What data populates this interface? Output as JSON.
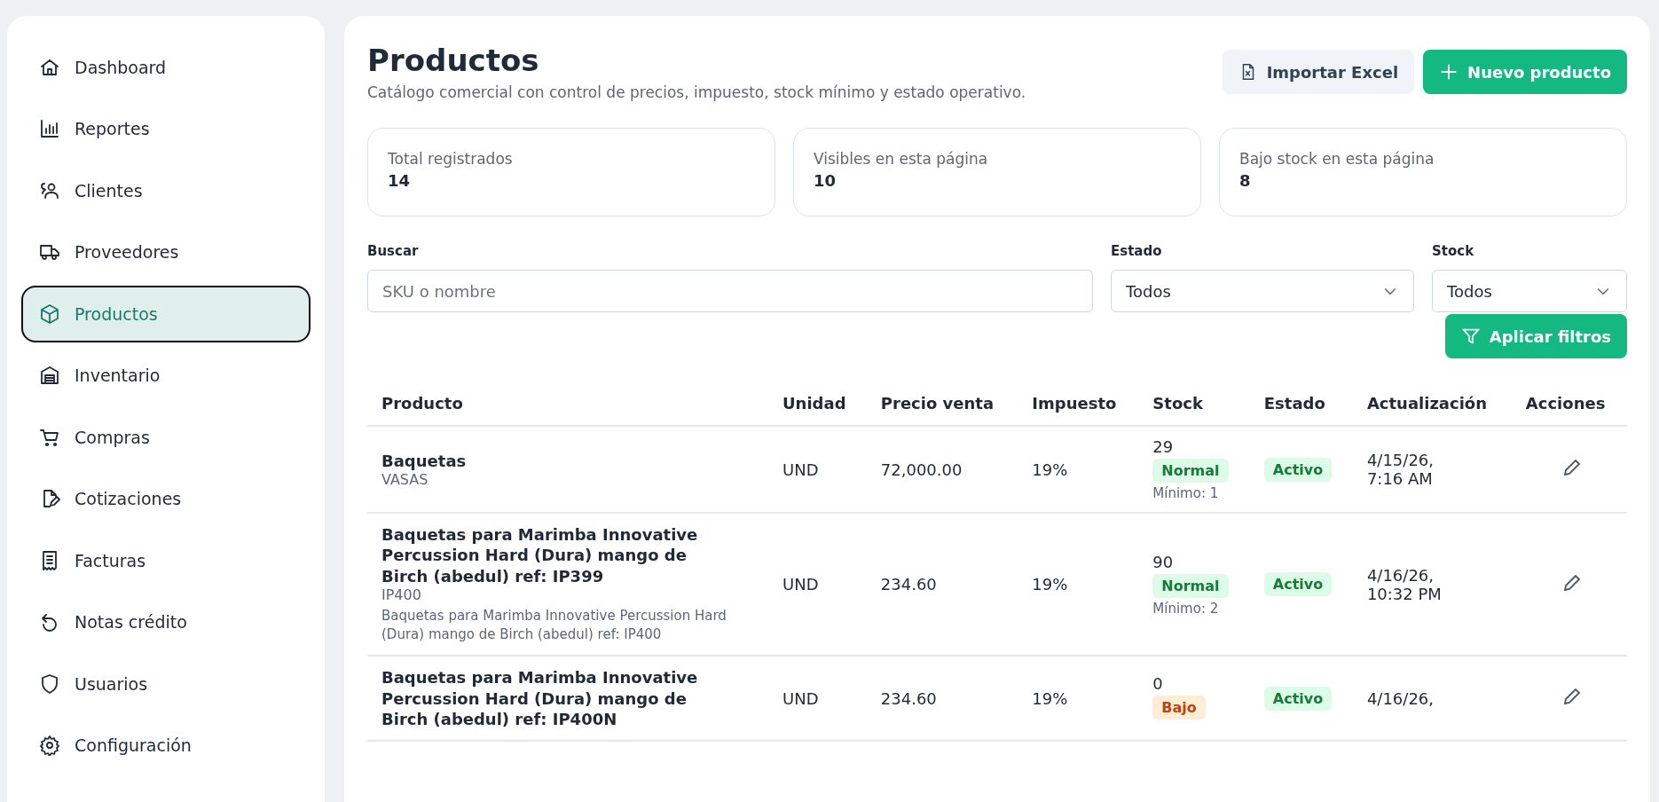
{
  "sidebar": {
    "items": [
      {
        "label": "Dashboard",
        "kind": "home",
        "selected": false
      },
      {
        "label": "Reportes",
        "kind": "chart",
        "selected": false
      },
      {
        "label": "Clientes",
        "kind": "users",
        "selected": false
      },
      {
        "label": "Proveedores",
        "kind": "truck",
        "selected": false
      },
      {
        "label": "Productos",
        "kind": "box",
        "selected": true
      },
      {
        "label": "Inventario",
        "kind": "warehouse",
        "selected": false
      },
      {
        "label": "Compras",
        "kind": "cart",
        "selected": false
      },
      {
        "label": "Cotizaciones",
        "kind": "doc",
        "selected": false
      },
      {
        "label": "Facturas",
        "kind": "receipt",
        "selected": false
      },
      {
        "label": "Notas crédito",
        "kind": "undo",
        "selected": false
      },
      {
        "label": "Usuarios",
        "kind": "shield",
        "selected": false
      },
      {
        "label": "Configuración",
        "kind": "gear",
        "selected": false
      }
    ]
  },
  "header": {
    "title": "Productos",
    "subtitle": "Catálogo comercial con control de precios, impuesto, stock mínimo y estado operativo.",
    "buttons": [
      {
        "label": "Importar Excel",
        "kind": "secondary"
      },
      {
        "label": "Nuevo producto",
        "kind": "primary"
      }
    ]
  },
  "stats": [
    {
      "label": "Total registrados",
      "value": "14"
    },
    {
      "label": "Visibles en esta página",
      "value": "10"
    },
    {
      "label": "Bajo stock en esta página",
      "value": "8"
    }
  ],
  "filters": {
    "search": {
      "label": "Buscar",
      "placeholder": "SKU o nombre"
    },
    "estado": {
      "label": "Estado",
      "value": "Todos"
    },
    "stock": {
      "label": "Stock",
      "value": "Todos"
    },
    "apply": "Aplicar filtros"
  },
  "table": {
    "columns": [
      "Producto",
      "Unidad",
      "Precio venta",
      "Impuesto",
      "Stock",
      "Estado",
      "Actualización",
      "Acciones"
    ],
    "rows": [
      {
        "name": "Baquetas",
        "sku": "VASAS",
        "unit": "UND",
        "price": "72,000.00",
        "tax": "19%",
        "stock": "29",
        "stock_status": {
          "label": "Normal",
          "kind": "normal"
        },
        "minimum": "Mínimo: 1",
        "status": "Activo",
        "updated": [
          "4/15/26,",
          "7:16 AM"
        ]
      },
      {
        "name": "Baquetas para Marimba Innovative Percussion Hard (Dura) mango de Birch (abedul) ref: IP399",
        "sku": "IP400",
        "description": "Baquetas para Marimba Innovative Percussion Hard (Dura) mango de Birch (abedul) ref: IP400",
        "unit": "UND",
        "price": "234.60",
        "tax": "19%",
        "stock": "90",
        "stock_status": {
          "label": "Normal",
          "kind": "normal"
        },
        "minimum": "Mínimo: 2",
        "status": "Activo",
        "updated": [
          "4/16/26,",
          "10:32 PM"
        ]
      },
      {
        "name": "Baquetas para Marimba Innovative Percussion Hard (Dura) mango de Birch (abedul) ref: IP400N",
        "unit": "UND",
        "price": "234.60",
        "tax": "19%",
        "stock": "0",
        "stock_status": {
          "label": "Bajo",
          "kind": "low"
        },
        "status": "Activo",
        "updated": [
          "4/16/26,"
        ]
      }
    ]
  }
}
